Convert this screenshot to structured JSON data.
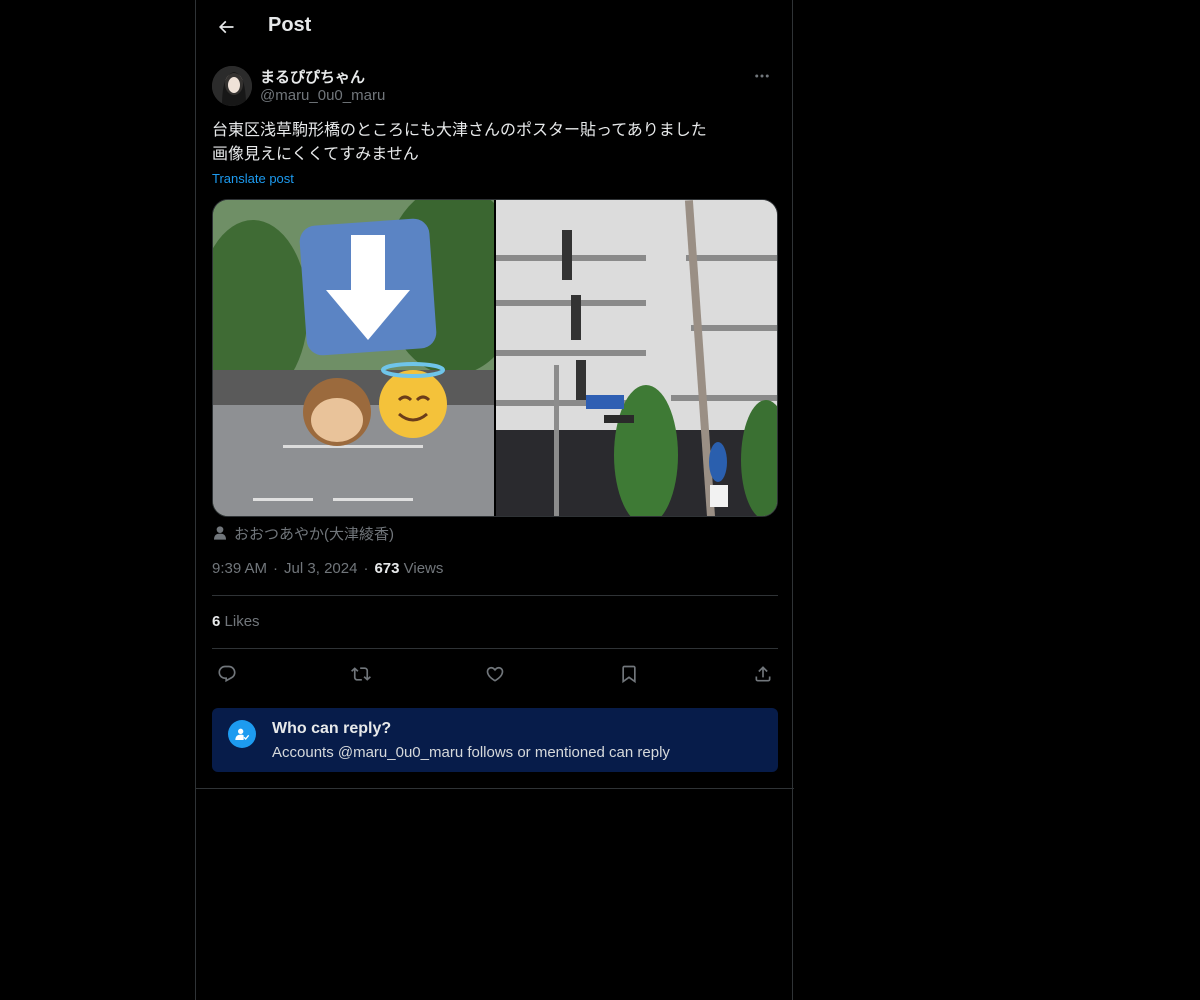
{
  "header": {
    "title": "Post"
  },
  "post": {
    "author": {
      "display_name": "まるぴぴちゃん",
      "handle": "@maru_0u0_maru"
    },
    "text": "台東区浅草駒形橋のところにも大津さんのポスター貼ってありました\n画像見えにくくてすみません",
    "translate_label": "Translate post",
    "tagged_user": "おおつあやか(大津綾香)",
    "time": "9:39 AM",
    "date": "Jul 3, 2024",
    "views_count": "673",
    "views_label": "Views",
    "likes_count": "6",
    "likes_label": "Likes"
  },
  "reply_restriction": {
    "title": "Who can reply?",
    "subtitle": "Accounts @maru_0u0_maru follows or mentioned can reply"
  },
  "icons": {
    "back": "arrow-left-icon",
    "more": "more-horizontal-icon",
    "reply": "reply-icon",
    "repost": "repost-icon",
    "like": "heart-icon",
    "bookmark": "bookmark-icon",
    "share": "share-icon",
    "tagged": "person-icon",
    "who_can_reply": "person-check-icon"
  },
  "colors": {
    "background": "#000000",
    "accent": "#1d9bf0",
    "reply_box": "#071c4a",
    "secondary_text": "#71767b"
  }
}
